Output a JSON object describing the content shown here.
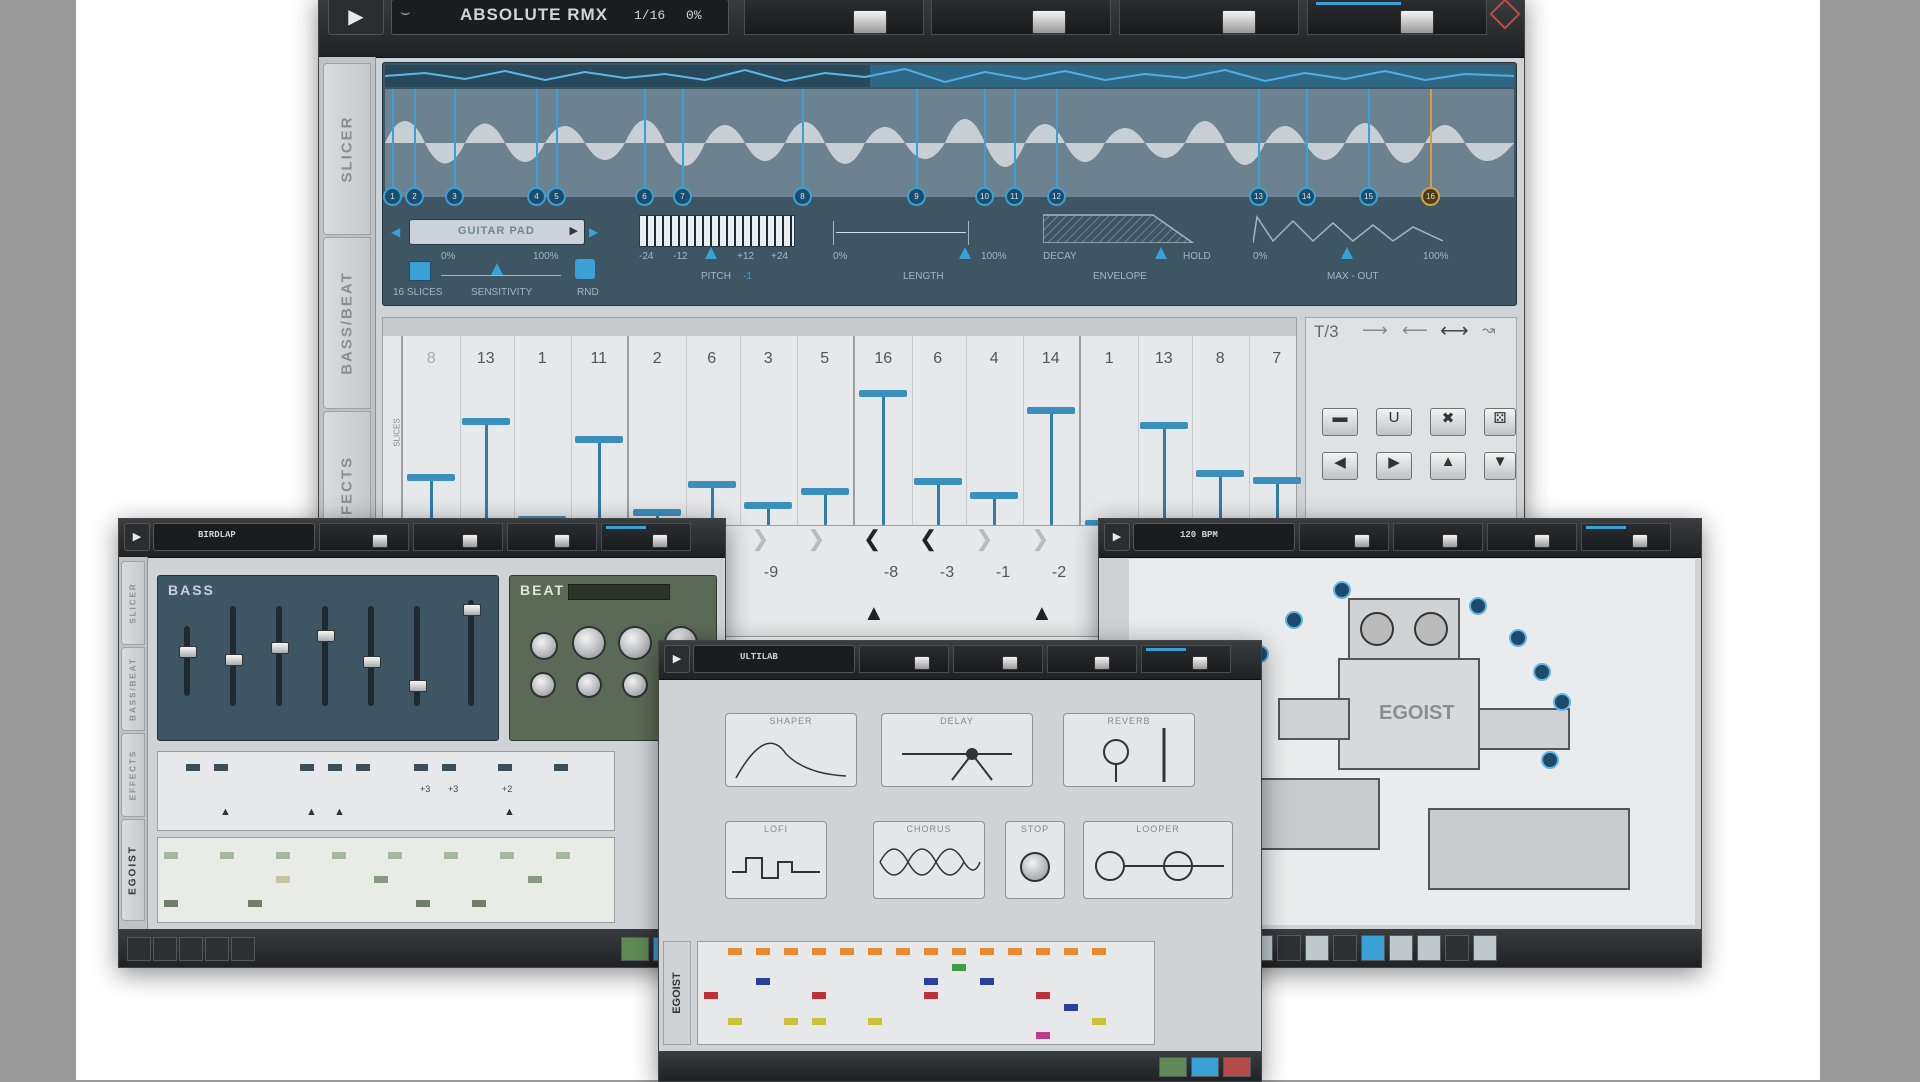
{
  "main": {
    "title": "ABSOLUTE RMX",
    "step": "1/16",
    "percent": "0%",
    "sidebar_tabs": [
      "SLICER",
      "BASS/BEAT",
      "EFFECTS"
    ],
    "slicer": {
      "sample_name": "GUITAR PAD",
      "slices_label": "16 SLICES",
      "sensitivity_label": "SENSITIVITY",
      "sens_min": "0%",
      "sens_max": "100%",
      "rnd_label": "RND",
      "pitch_label": "PITCH",
      "pitch_value": "-1",
      "pitch_ticks": [
        "-24",
        "-12",
        "+12",
        "+24"
      ],
      "length_label": "LENGTH",
      "length_min": "0%",
      "length_max": "100%",
      "envelope_label": "ENVELOPE",
      "decay_label": "DECAY",
      "hold_label": "HOLD",
      "maxout_label": "MAX - OUT",
      "maxout_min": "0%",
      "maxout_max": "100%",
      "markers": [
        "1",
        "2",
        "3",
        "4",
        "5",
        "6",
        "7",
        "8",
        "9",
        "10",
        "11",
        "12",
        "13",
        "14",
        "15",
        "16"
      ]
    },
    "sequencer": {
      "mode": "T/3",
      "slices_side_label": "SLICES",
      "steps": [
        "8",
        "13",
        "1",
        "11",
        "2",
        "6",
        "3",
        "5",
        "16",
        "6",
        "4",
        "14",
        "1",
        "13",
        "8",
        "7"
      ],
      "levels": [
        0.35,
        0.75,
        0.05,
        0.62,
        0.1,
        0.3,
        0.15,
        0.25,
        0.95,
        0.32,
        0.22,
        0.83,
        0.02,
        0.72,
        0.38,
        0.33
      ],
      "pitch_values": [
        "-9",
        "-8",
        "-3",
        "-1",
        "-2"
      ]
    }
  },
  "left_window": {
    "title": "BIRDLAP",
    "bass_label": "BASS",
    "beat_label": "BEAT",
    "sidebar_tabs": [
      "SLICER",
      "BASS/BEAT",
      "EFFECTS",
      "EGOIST"
    ],
    "grid_values": [
      "+3",
      "+3",
      "+2"
    ]
  },
  "center_window": {
    "title": "ULTILAB",
    "fx": [
      "SHAPER",
      "DELAY",
      "REVERB",
      "LOFI",
      "CHORUS",
      "STOP",
      "LOOPER"
    ],
    "brand": "EGOIST"
  },
  "right_window": {
    "title": "120 BPM",
    "robot_label": "EGOIST"
  }
}
